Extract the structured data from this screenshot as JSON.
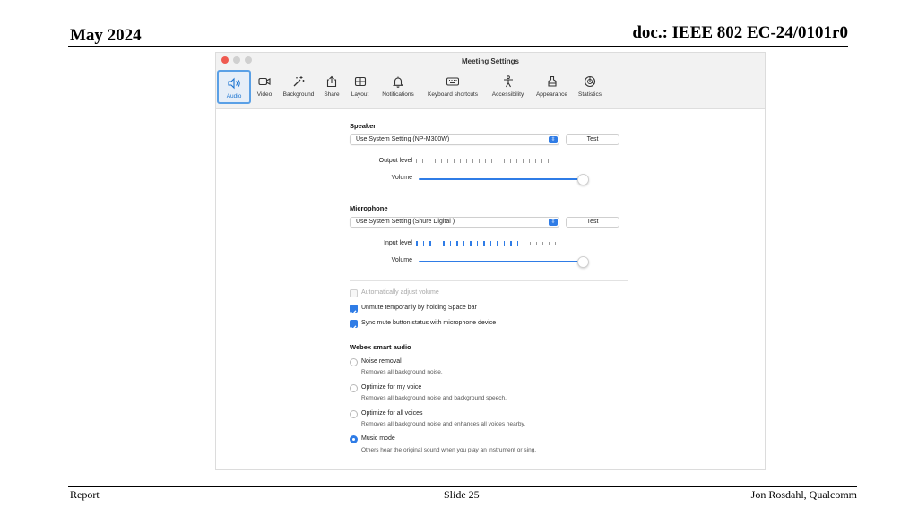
{
  "slide": {
    "date": "May 2024",
    "doc_id": "doc.: IEEE 802 EC-24/0101r0",
    "footer_left": "Report",
    "footer_center": "Slide 25",
    "footer_right": "Jon Rosdahl, Qualcomm"
  },
  "window": {
    "title": "Meeting Settings",
    "tabs": [
      {
        "label": "Audio",
        "icon": "speaker-icon",
        "active": true
      },
      {
        "label": "Video",
        "icon": "camera-icon"
      },
      {
        "label": "Background",
        "icon": "magic-wand-icon"
      },
      {
        "label": "Share",
        "icon": "share-icon"
      },
      {
        "label": "Layout",
        "icon": "layout-grid-icon"
      },
      {
        "label": "Notifications",
        "icon": "bell-icon"
      },
      {
        "label": "Keyboard shortcuts",
        "icon": "keyboard-icon"
      },
      {
        "label": "Accessibility",
        "icon": "accessibility-icon"
      },
      {
        "label": "Appearance",
        "icon": "appearance-icon"
      },
      {
        "label": "Statistics",
        "icon": "statistics-icon"
      }
    ]
  },
  "speaker": {
    "title": "Speaker",
    "device": "Use System Setting (NP-M300W)",
    "test": "Test",
    "output_label": "Output level",
    "output_level_active_ticks": 0,
    "meter_ticks": 22,
    "volume_label": "Volume",
    "volume": 1.0
  },
  "microphone": {
    "title": "Microphone",
    "device": "Use System Setting (Shure Digital   )",
    "test": "Test",
    "input_label": "Input level",
    "input_level_active_ticks": 16,
    "meter_ticks": 22,
    "volume_label": "Volume",
    "volume": 1.0
  },
  "options": {
    "auto_adjust": {
      "label": "Automatically adjust volume",
      "checked": false,
      "disabled": true
    },
    "unmute_space": {
      "label": "Unmute temporarily by holding Space bar",
      "checked": true
    },
    "sync_mute": {
      "label": "Sync mute button status with microphone device",
      "checked": true
    }
  },
  "smart_audio": {
    "title": "Webex smart audio",
    "options": [
      {
        "label": "Noise removal",
        "desc": "Removes all background noise.",
        "selected": false
      },
      {
        "label": "Optimize for my voice",
        "desc": "Removes all background noise and background speech.",
        "selected": false
      },
      {
        "label": "Optimize for all voices",
        "desc": "Removes all background noise and enhances all voices nearby.",
        "selected": false
      },
      {
        "label": "Music mode",
        "desc": "Others hear the original sound when you play an instrument or sing.",
        "selected": true
      }
    ]
  },
  "colors": {
    "accent": "#2f7ce6",
    "tab_highlight": "#5aa0e6"
  }
}
